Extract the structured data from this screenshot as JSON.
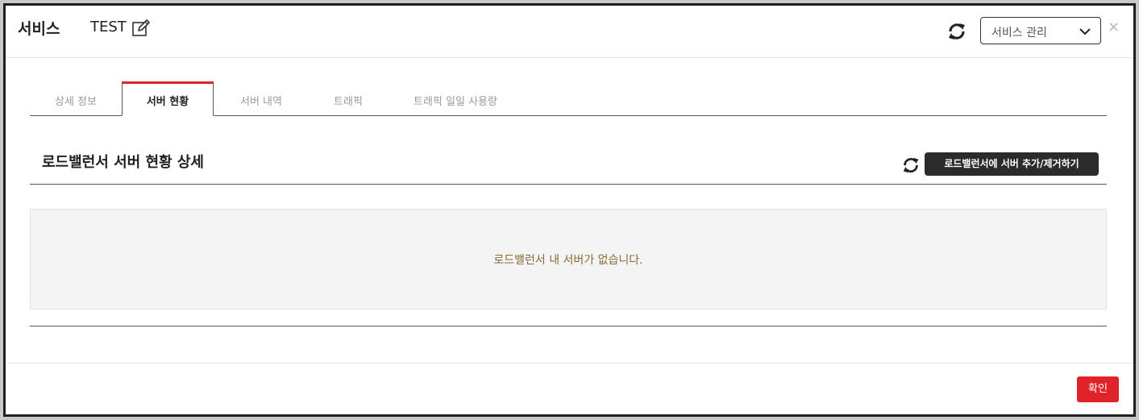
{
  "modal": {
    "title": "서비스",
    "service_name": "TEST",
    "select_label": "서비스 관리",
    "close_label": "×",
    "confirm_label": "확인"
  },
  "tabs": [
    {
      "label": "상세 정보",
      "active": false
    },
    {
      "label": "서버 현황",
      "active": true
    },
    {
      "label": "서버 내역",
      "active": false
    },
    {
      "label": "트래픽",
      "active": false
    },
    {
      "label": "트래픽 일일 사용량",
      "active": false
    }
  ],
  "section": {
    "title": "로드밸런서 서버 현황 상세",
    "action_label": "로드밸런서에 서버 추가/제거하기",
    "empty_message": "로드밸런서 내 서버가 없습니다."
  },
  "icons": {
    "edit": "edit-icon",
    "refresh": "refresh-icon",
    "chevron": "chevron-down-icon"
  },
  "colors": {
    "accent": "#e0232a",
    "dark_button": "#2b2b2b",
    "empty_text": "#8a6a3a"
  }
}
